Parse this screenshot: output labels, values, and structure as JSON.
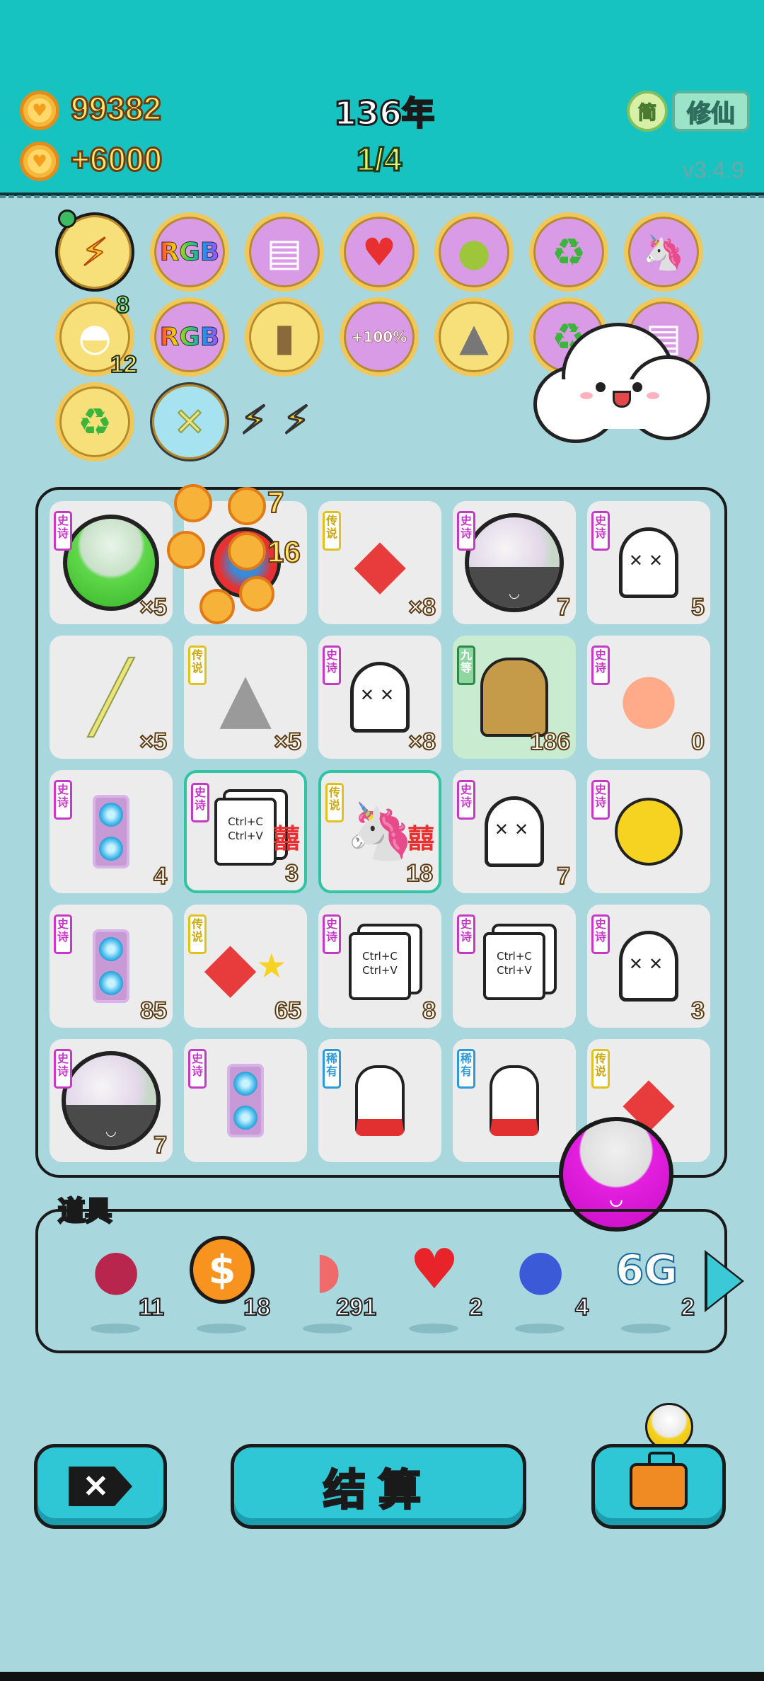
{
  "hud": {
    "coins": "99382",
    "income": "+6000",
    "year": "136年",
    "progress": "1/4",
    "simplified_label": "简",
    "cultivate_label": "修仙",
    "version": "v3.4.9"
  },
  "relics": {
    "row1": [
      "bolt-icon",
      "RGB",
      "skirt-icon",
      "heart-potion-icon",
      "pomelo-icon",
      "recycle-icon",
      "unicorn-icon"
    ],
    "row2": [
      "shell-icon",
      "RGB",
      "tapioca-tea-icon",
      "+100%",
      "husky-icon",
      "recycle-icon",
      "skirt-icon"
    ],
    "row3": [
      "recycle-icon",
      "straws-icon"
    ],
    "rgb_label": "RGB",
    "plus100_label": "+100%",
    "shell_count_top": "8",
    "shell_count_bottom": "12"
  },
  "floating_coins": {
    "a": "7",
    "b": "16"
  },
  "board": {
    "tags": {
      "epic": "史诗",
      "legend": "传说",
      "rare": "稀有",
      "nine": "九等"
    },
    "ctrl_label_1": "Ctrl+C",
    "ctrl_label_2": "Ctrl+V",
    "double_happy": "囍",
    "cells": [
      {
        "tag": "epic",
        "icon": "green-bowl-icon",
        "count": "×5"
      },
      {
        "tag": "",
        "icon": "coin-pile-icon",
        "count": ""
      },
      {
        "tag": "legend",
        "icon": "fish-icon",
        "count": "×8"
      },
      {
        "tag": "epic",
        "icon": "mochi-bowl-icon",
        "count": "7"
      },
      {
        "tag": "epic",
        "icon": "ghost-icon",
        "count": "5"
      },
      {
        "tag": "",
        "icon": "straw-icon",
        "count": "×5"
      },
      {
        "tag": "legend",
        "icon": "husky-king-icon",
        "count": "×5"
      },
      {
        "tag": "epic",
        "icon": "ghost-icon",
        "count": "×8"
      },
      {
        "tag": "nine",
        "icon": "bubble-tea-icon",
        "count": "186"
      },
      {
        "tag": "epic",
        "icon": "peach-icon",
        "count": "0"
      },
      {
        "tag": "epic",
        "icon": "gpu-icon",
        "count": "4"
      },
      {
        "tag": "epic",
        "icon": "ctrl-cv-icon",
        "count": "3"
      },
      {
        "tag": "legend",
        "icon": "unicorn-icon",
        "count": "18"
      },
      {
        "tag": "epic",
        "icon": "ghost-icon",
        "count": "7"
      },
      {
        "tag": "epic",
        "icon": "yellow-face-icon",
        "count": ""
      },
      {
        "tag": "epic",
        "icon": "gpu-icon",
        "count": "85"
      },
      {
        "tag": "legend",
        "icon": "fish-star-icon",
        "count": "65"
      },
      {
        "tag": "epic",
        "icon": "ctrl-cv-icon",
        "count": "8"
      },
      {
        "tag": "epic",
        "icon": "ctrl-cv-icon",
        "count": ""
      },
      {
        "tag": "epic",
        "icon": "ghost-icon",
        "count": "3"
      },
      {
        "tag": "epic",
        "icon": "mochi-bowl-icon",
        "count": "7"
      },
      {
        "tag": "epic",
        "icon": "gpu-icon",
        "count": ""
      },
      {
        "tag": "rare",
        "icon": "bunny-icon",
        "count": ""
      },
      {
        "tag": "rare",
        "icon": "bunny-icon",
        "count": ""
      },
      {
        "tag": "legend",
        "icon": "fish-icon",
        "count": ""
      }
    ]
  },
  "items": {
    "label": "道具",
    "list": [
      {
        "icon": "lychee-icon",
        "count": "11"
      },
      {
        "icon": "dollar-coin-icon",
        "count": "18"
      },
      {
        "icon": "liver-icon",
        "count": "291"
      },
      {
        "icon": "strawberry-icon",
        "count": "2"
      },
      {
        "icon": "blueberry-icon",
        "count": "4"
      },
      {
        "icon": "6g-icon",
        "count": "2"
      }
    ],
    "six_g": "6G"
  },
  "actions": {
    "settle_label": "结算"
  },
  "colors": {
    "top_bar": "#17c3c1",
    "background": "#a8d7de",
    "button": "#2fc6d6",
    "epic_tag": "#c638c6",
    "legend_tag": "#e0c21c"
  }
}
